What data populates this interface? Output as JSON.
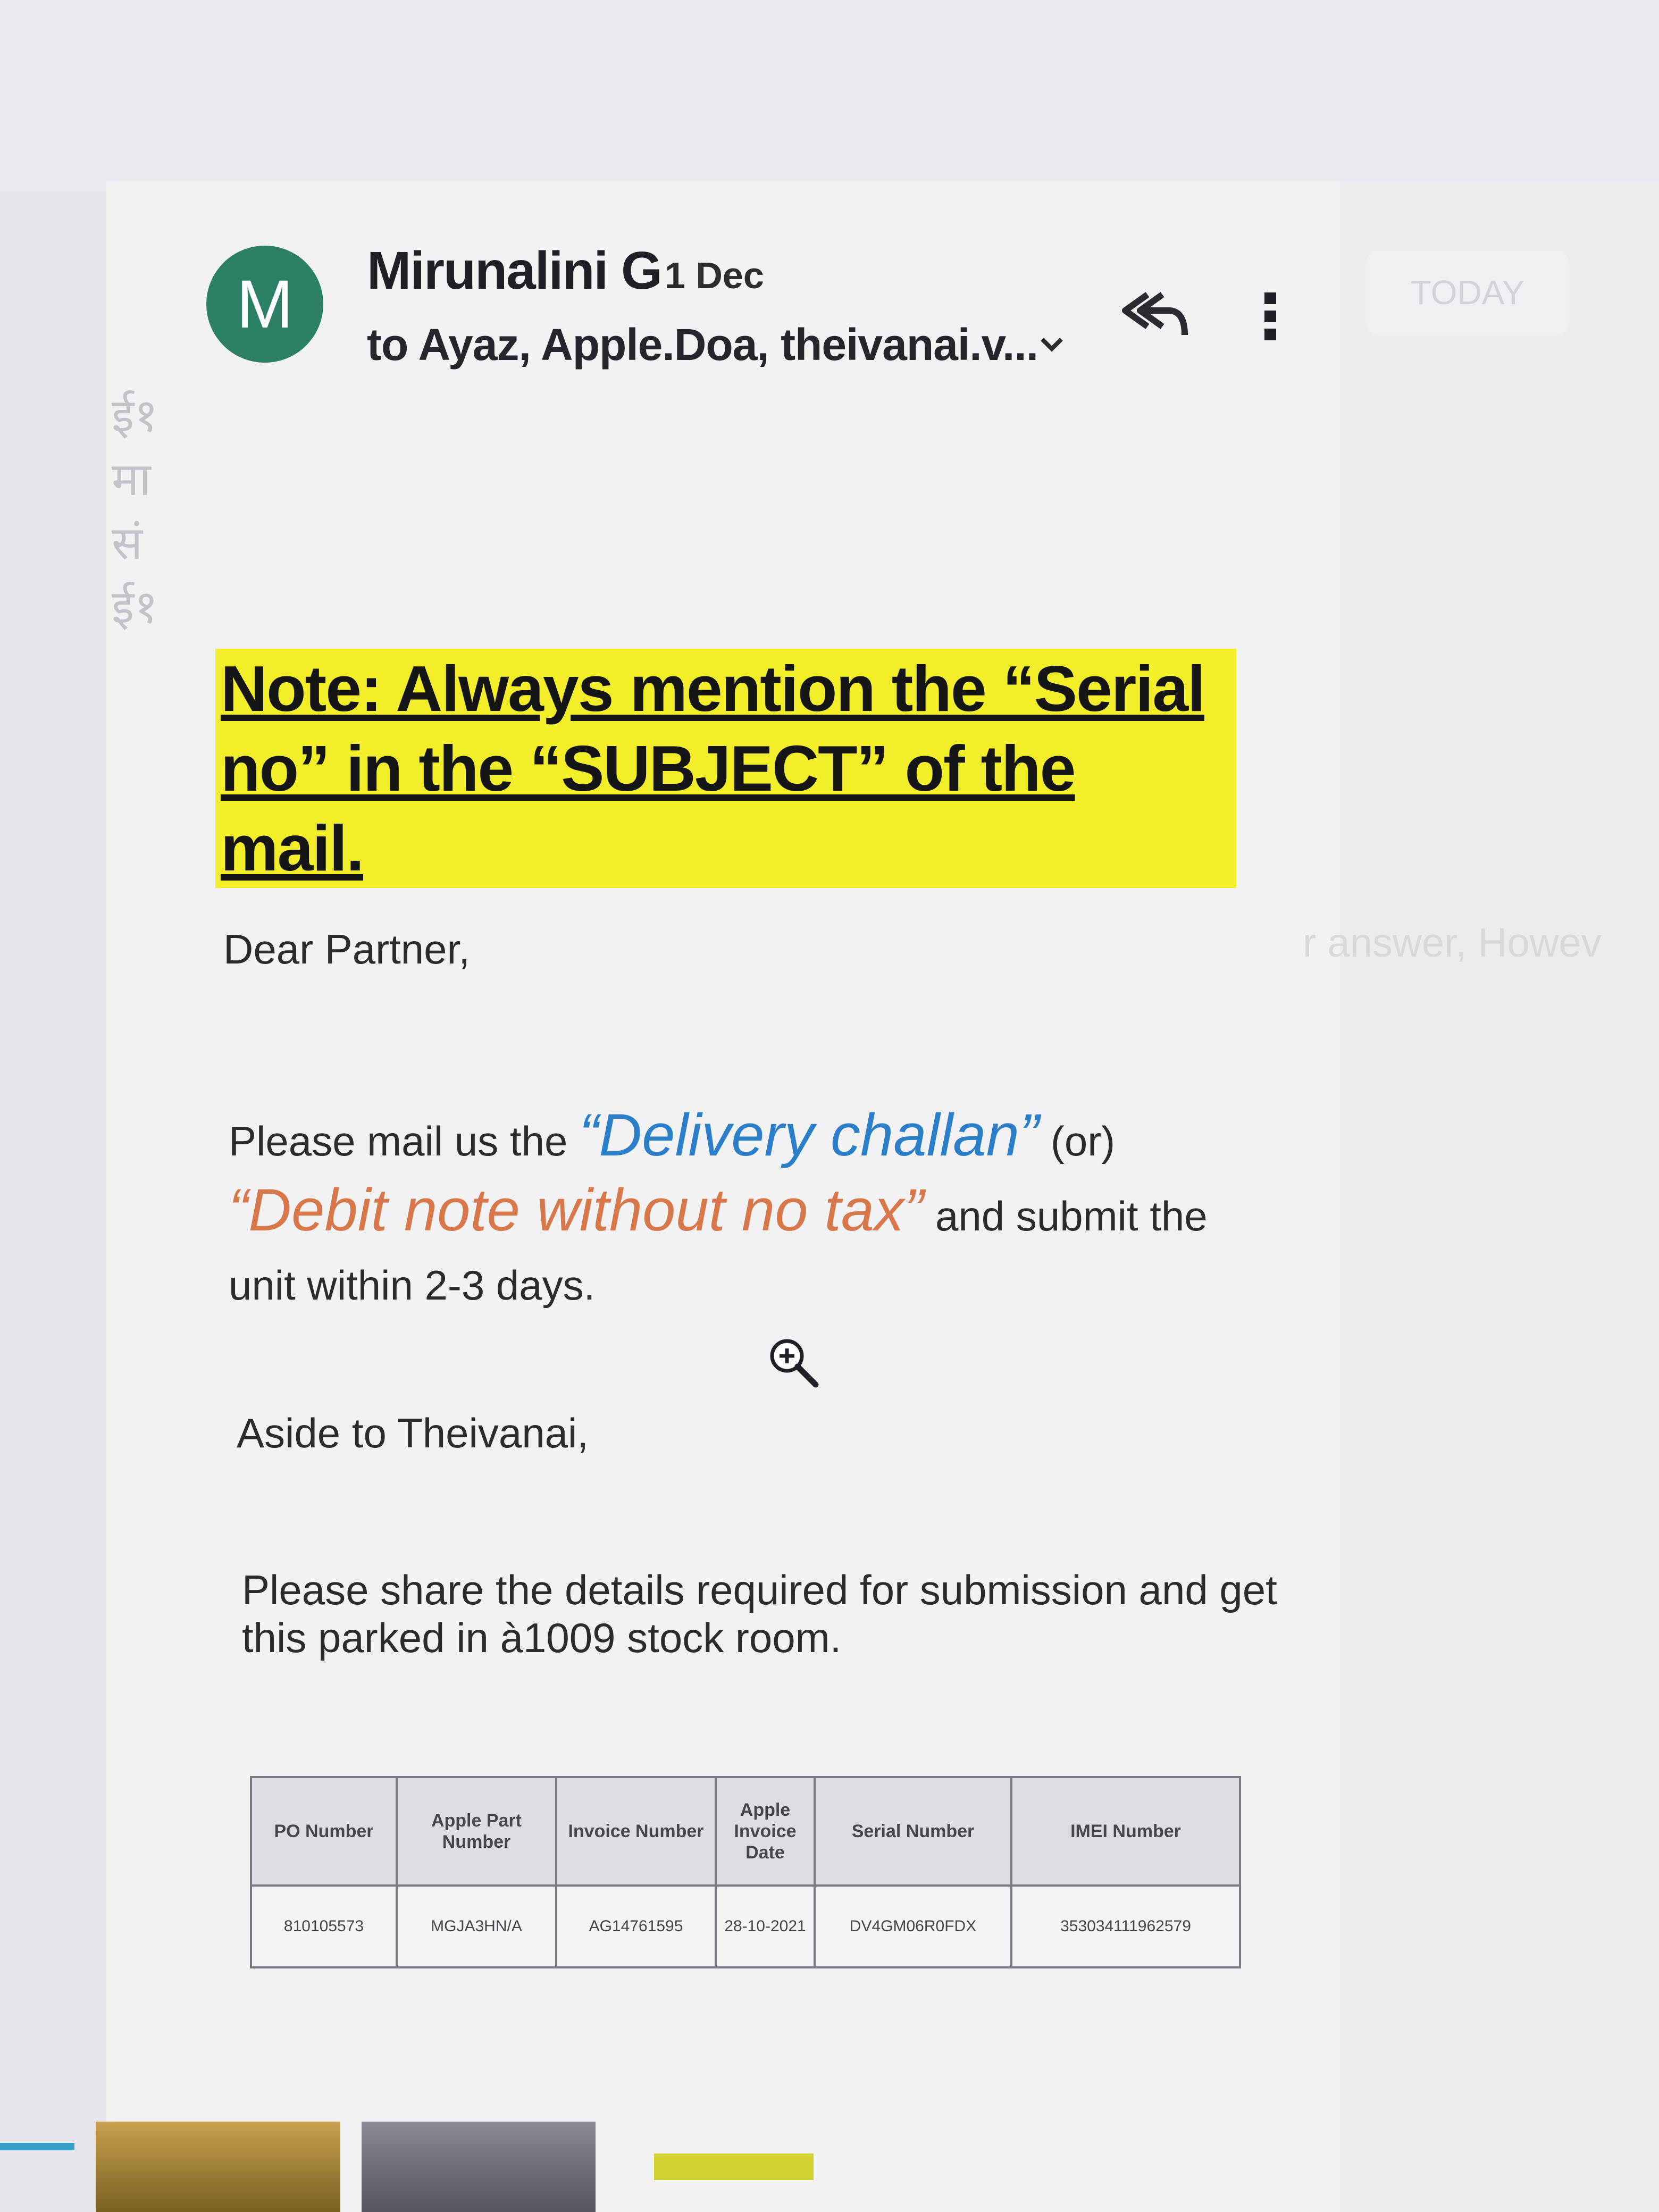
{
  "email": {
    "avatar_letter": "M",
    "sender": "Mirunalini G",
    "date": "1 Dec",
    "recipients": "to Ayaz, Apple.Doa, theivanai.v...",
    "note_line1": "Note: Always mention the “Serial",
    "note_line2": "no” in the “SUBJECT” of the mail.",
    "greeting": "Dear Partner,",
    "para1": {
      "before": "Please mail us the ",
      "delivery_challan": "“Delivery challan”",
      "or": " (or) ",
      "debit_note": "“Debit note without no tax”",
      "after": " and submit the unit within 2-3 days."
    },
    "aside": "Aside to Theivanai,",
    "para2": "Please share the details required for submission and get this parked in à1009 stock room.",
    "table": {
      "headers": [
        "PO Number",
        "Apple Part Number",
        "Invoice Number",
        "Apple Invoice Date",
        "Serial Number",
        "IMEI Number"
      ],
      "row": [
        "810105573",
        "MGJA3HN/A",
        "AG14761595",
        "28-10-2021",
        "DV4GM06R0FDX",
        "353034111962579"
      ]
    }
  },
  "background": {
    "today_chip": "TODAY",
    "right_snippet": "r answer, Howev",
    "left_glyphs": [
      "ई१",
      "मा",
      "सं",
      "ई१"
    ]
  },
  "colors": {
    "avatar_bg": "#2a7f66",
    "highlight": "#f2ef2a",
    "link_blue": "#2a7fc8",
    "accent_orange": "#d8784a"
  },
  "icons": [
    "reply-all-icon",
    "more-vert-icon",
    "chevron-down-icon",
    "zoom-in-cursor-icon"
  ]
}
